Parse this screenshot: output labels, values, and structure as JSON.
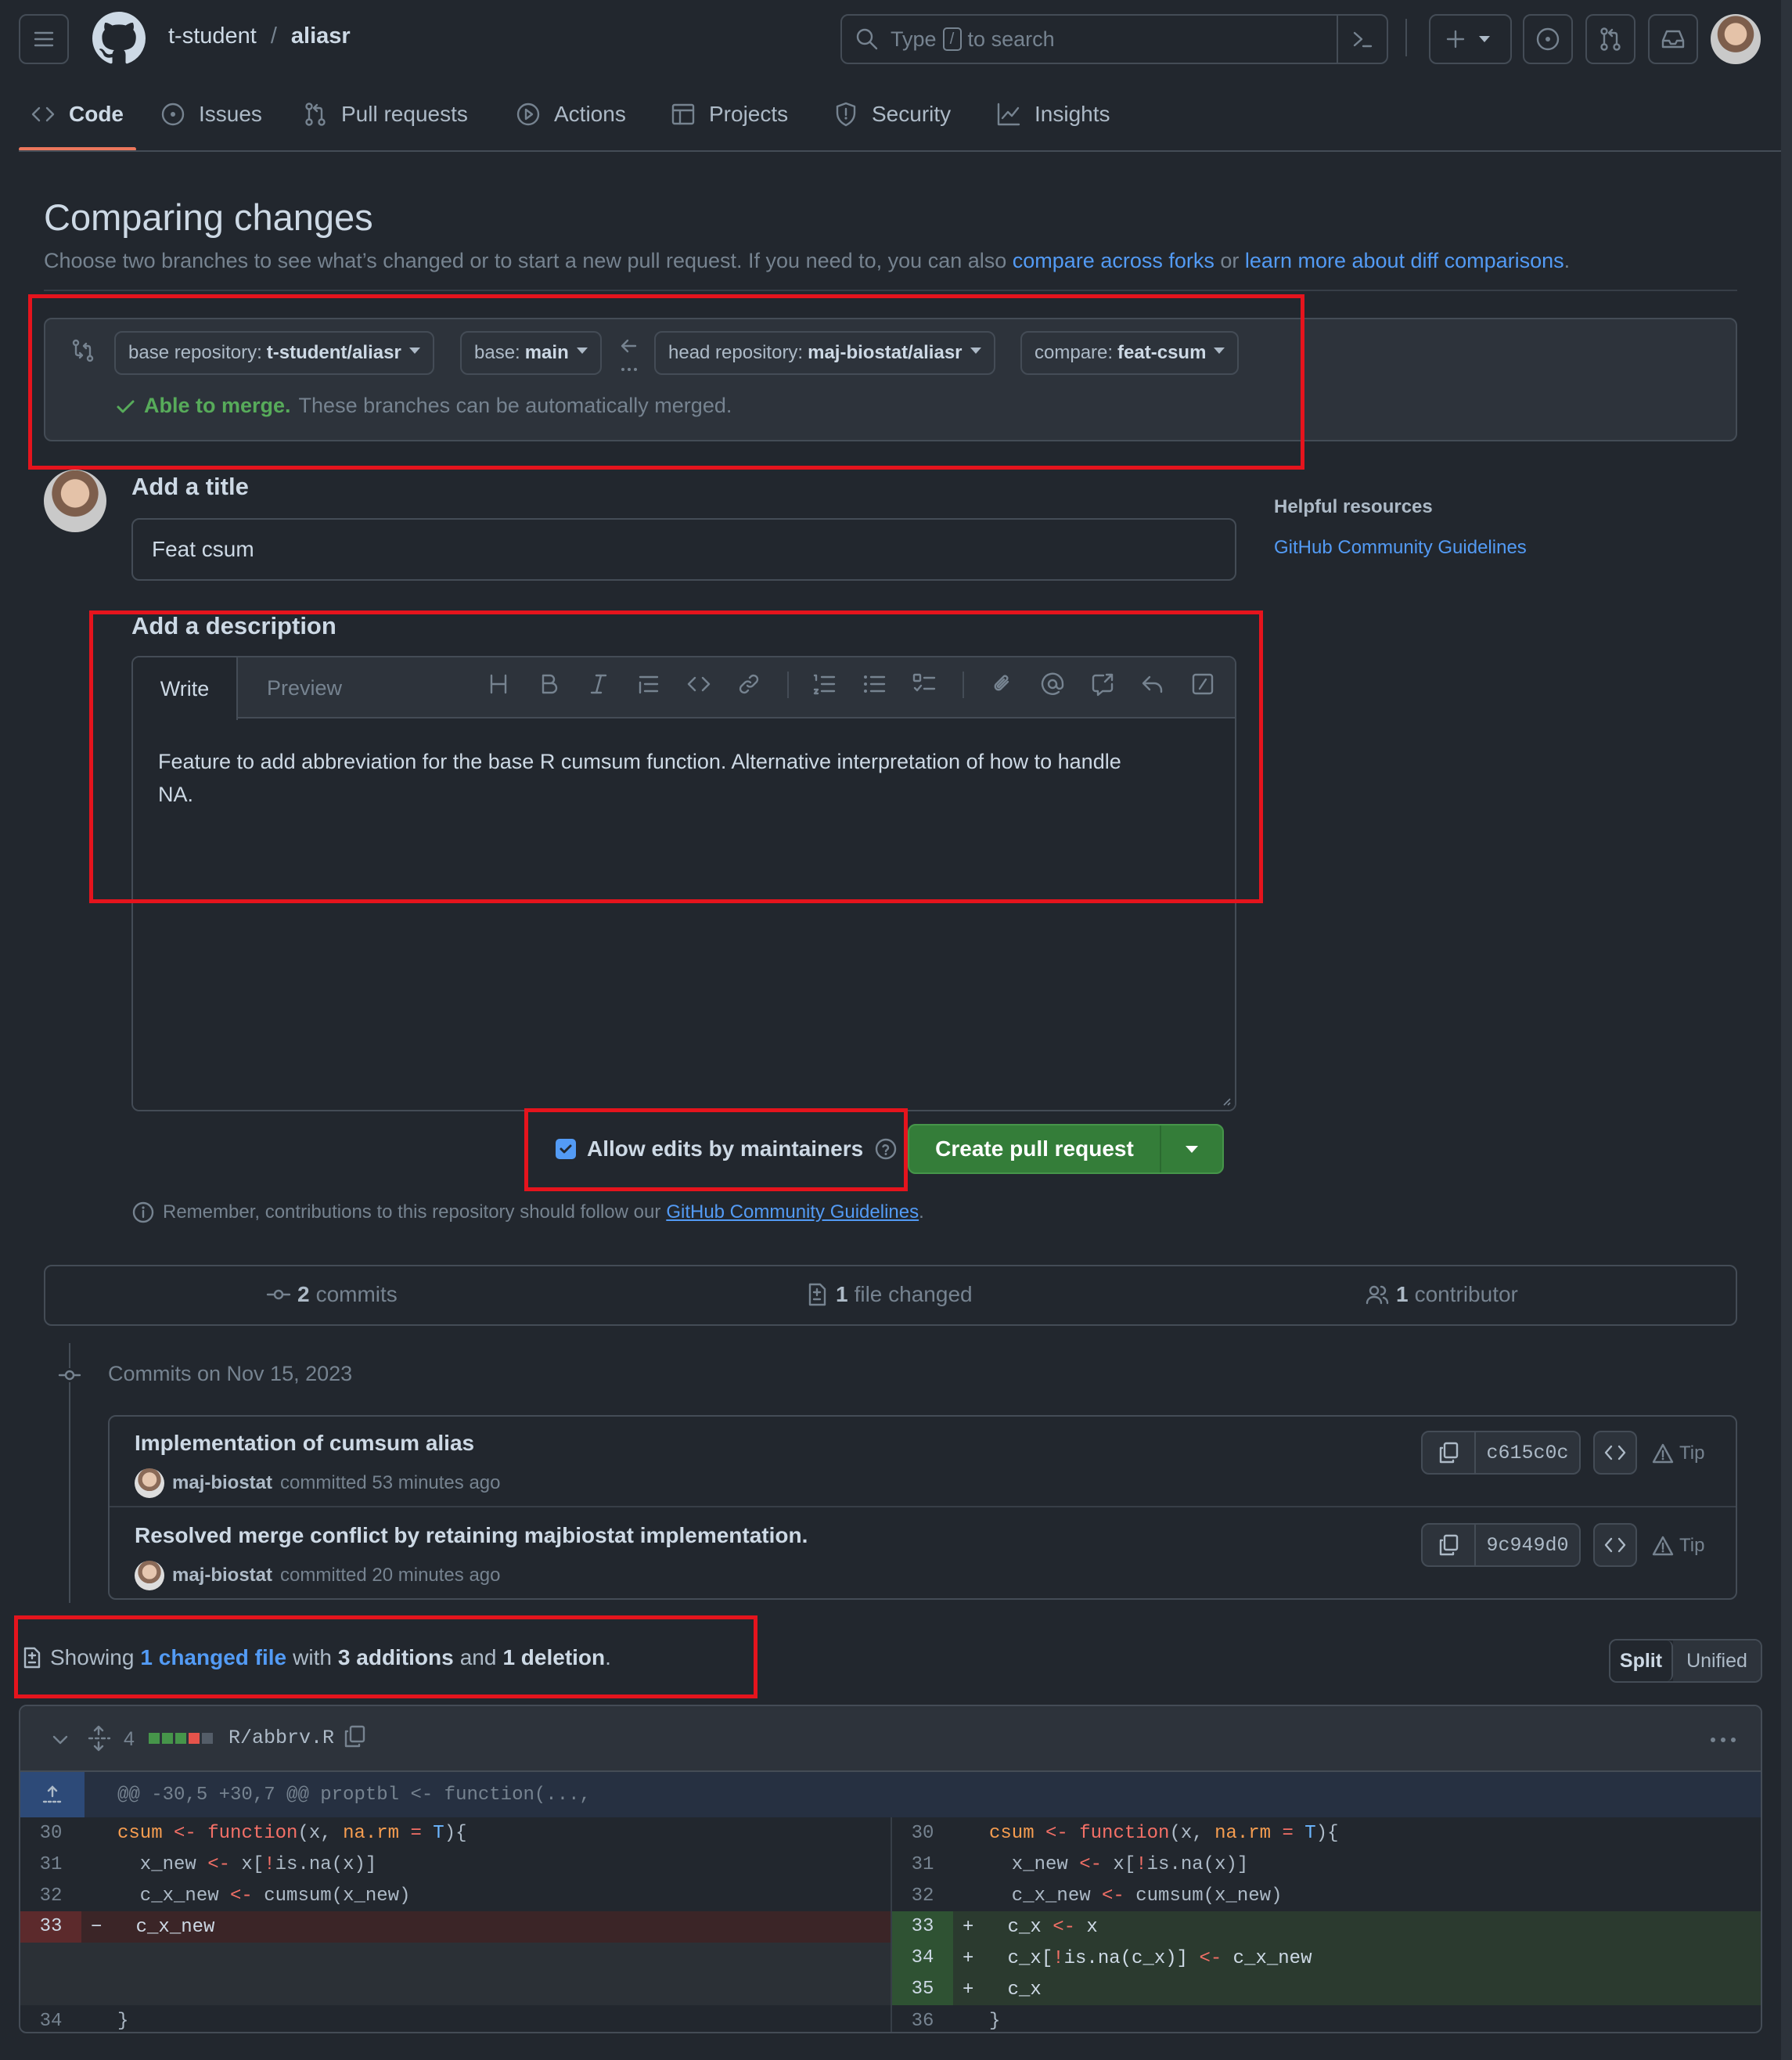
{
  "header": {
    "owner": "t-student",
    "separator": "/",
    "repo": "aliasr",
    "search_placeholder_pre": "Type",
    "search_key": "/",
    "search_placeholder_post": "to search"
  },
  "nav": [
    {
      "label": "Code",
      "icon": "code-icon"
    },
    {
      "label": "Issues",
      "icon": "issue-icon"
    },
    {
      "label": "Pull requests",
      "icon": "pull-request-icon"
    },
    {
      "label": "Actions",
      "icon": "play-icon"
    },
    {
      "label": "Projects",
      "icon": "table-icon"
    },
    {
      "label": "Security",
      "icon": "shield-icon"
    },
    {
      "label": "Insights",
      "icon": "graph-icon"
    }
  ],
  "page": {
    "title": "Comparing changes",
    "subtitle_pre": "Choose two branches to see what’s changed or to start a new pull request. If you need to, you can also",
    "link_forks": "compare across forks",
    "subtitle_or": "or",
    "link_learn": "learn more about diff comparisons",
    "subtitle_end": "."
  },
  "compare": {
    "base_repo_label": "base repository:",
    "base_repo_value": "t-student/aliasr",
    "base_label": "base:",
    "base_value": "main",
    "head_repo_label": "head repository:",
    "head_repo_value": "maj-biostat/aliasr",
    "compare_label": "compare:",
    "compare_value": "feat-csum",
    "merge_status": "Able to merge.",
    "merge_detail": "These branches can be automatically merged."
  },
  "form": {
    "title_label": "Add a title",
    "title_value": "Feat csum",
    "desc_label": "Add a description",
    "tab_write": "Write",
    "tab_preview": "Preview",
    "description_line1": "Feature to add abbreviation for the base R cumsum function. Alternative interpretation of how to handle",
    "description_line2": "NA.",
    "allow_edits": "Allow edits by maintainers",
    "allow_edits_checked": true,
    "create_button": "Create pull request",
    "remember_pre": "Remember, contributions to this repository should follow our",
    "remember_link": "GitHub Community Guidelines",
    "remember_end": "."
  },
  "sidebar": {
    "heading": "Helpful resources",
    "link": "GitHub Community Guidelines"
  },
  "stats": {
    "commits_count": "2",
    "commits_label": "commits",
    "files_count": "1",
    "files_label": "file changed",
    "contributors_count": "1",
    "contributors_label": "contributor"
  },
  "commits": {
    "date_heading": "Commits on Nov 15, 2023",
    "items": [
      {
        "title": "Implementation of cumsum alias",
        "author": "maj-biostat",
        "meta": "committed 53 minutes ago",
        "sha": "c615c0c",
        "tip": "Tip"
      },
      {
        "title": "Resolved merge conflict by retaining majbiostat implementation.",
        "author": "maj-biostat",
        "meta": "committed 20 minutes ago",
        "sha": "9c949d0",
        "tip": "Tip"
      }
    ]
  },
  "summary": {
    "showing": "Showing",
    "changed_link": "1 changed file",
    "with": "with",
    "additions": "3 additions",
    "and": "and",
    "deletions": "1 deletion",
    "end": ".",
    "split": "Split",
    "unified": "Unified"
  },
  "diff": {
    "change_count": "4",
    "filename": "R/abbrv.R",
    "hunk_header": "@@ -30,5 +30,7 @@ proptbl <- function(...,",
    "left_numbers": [
      "30",
      "31",
      "32",
      "33",
      "34"
    ],
    "right_numbers": [
      "30",
      "31",
      "32",
      "33",
      "34",
      "35",
      "36"
    ]
  },
  "colors": {
    "background": "#22272e",
    "accent_link": "#539bf5",
    "success": "#57ab5a",
    "primary_button": "#347d39",
    "annotation_box": "#e5141d",
    "deletion_bg": "#3b2527",
    "addition_bg": "#2b3a2f"
  }
}
